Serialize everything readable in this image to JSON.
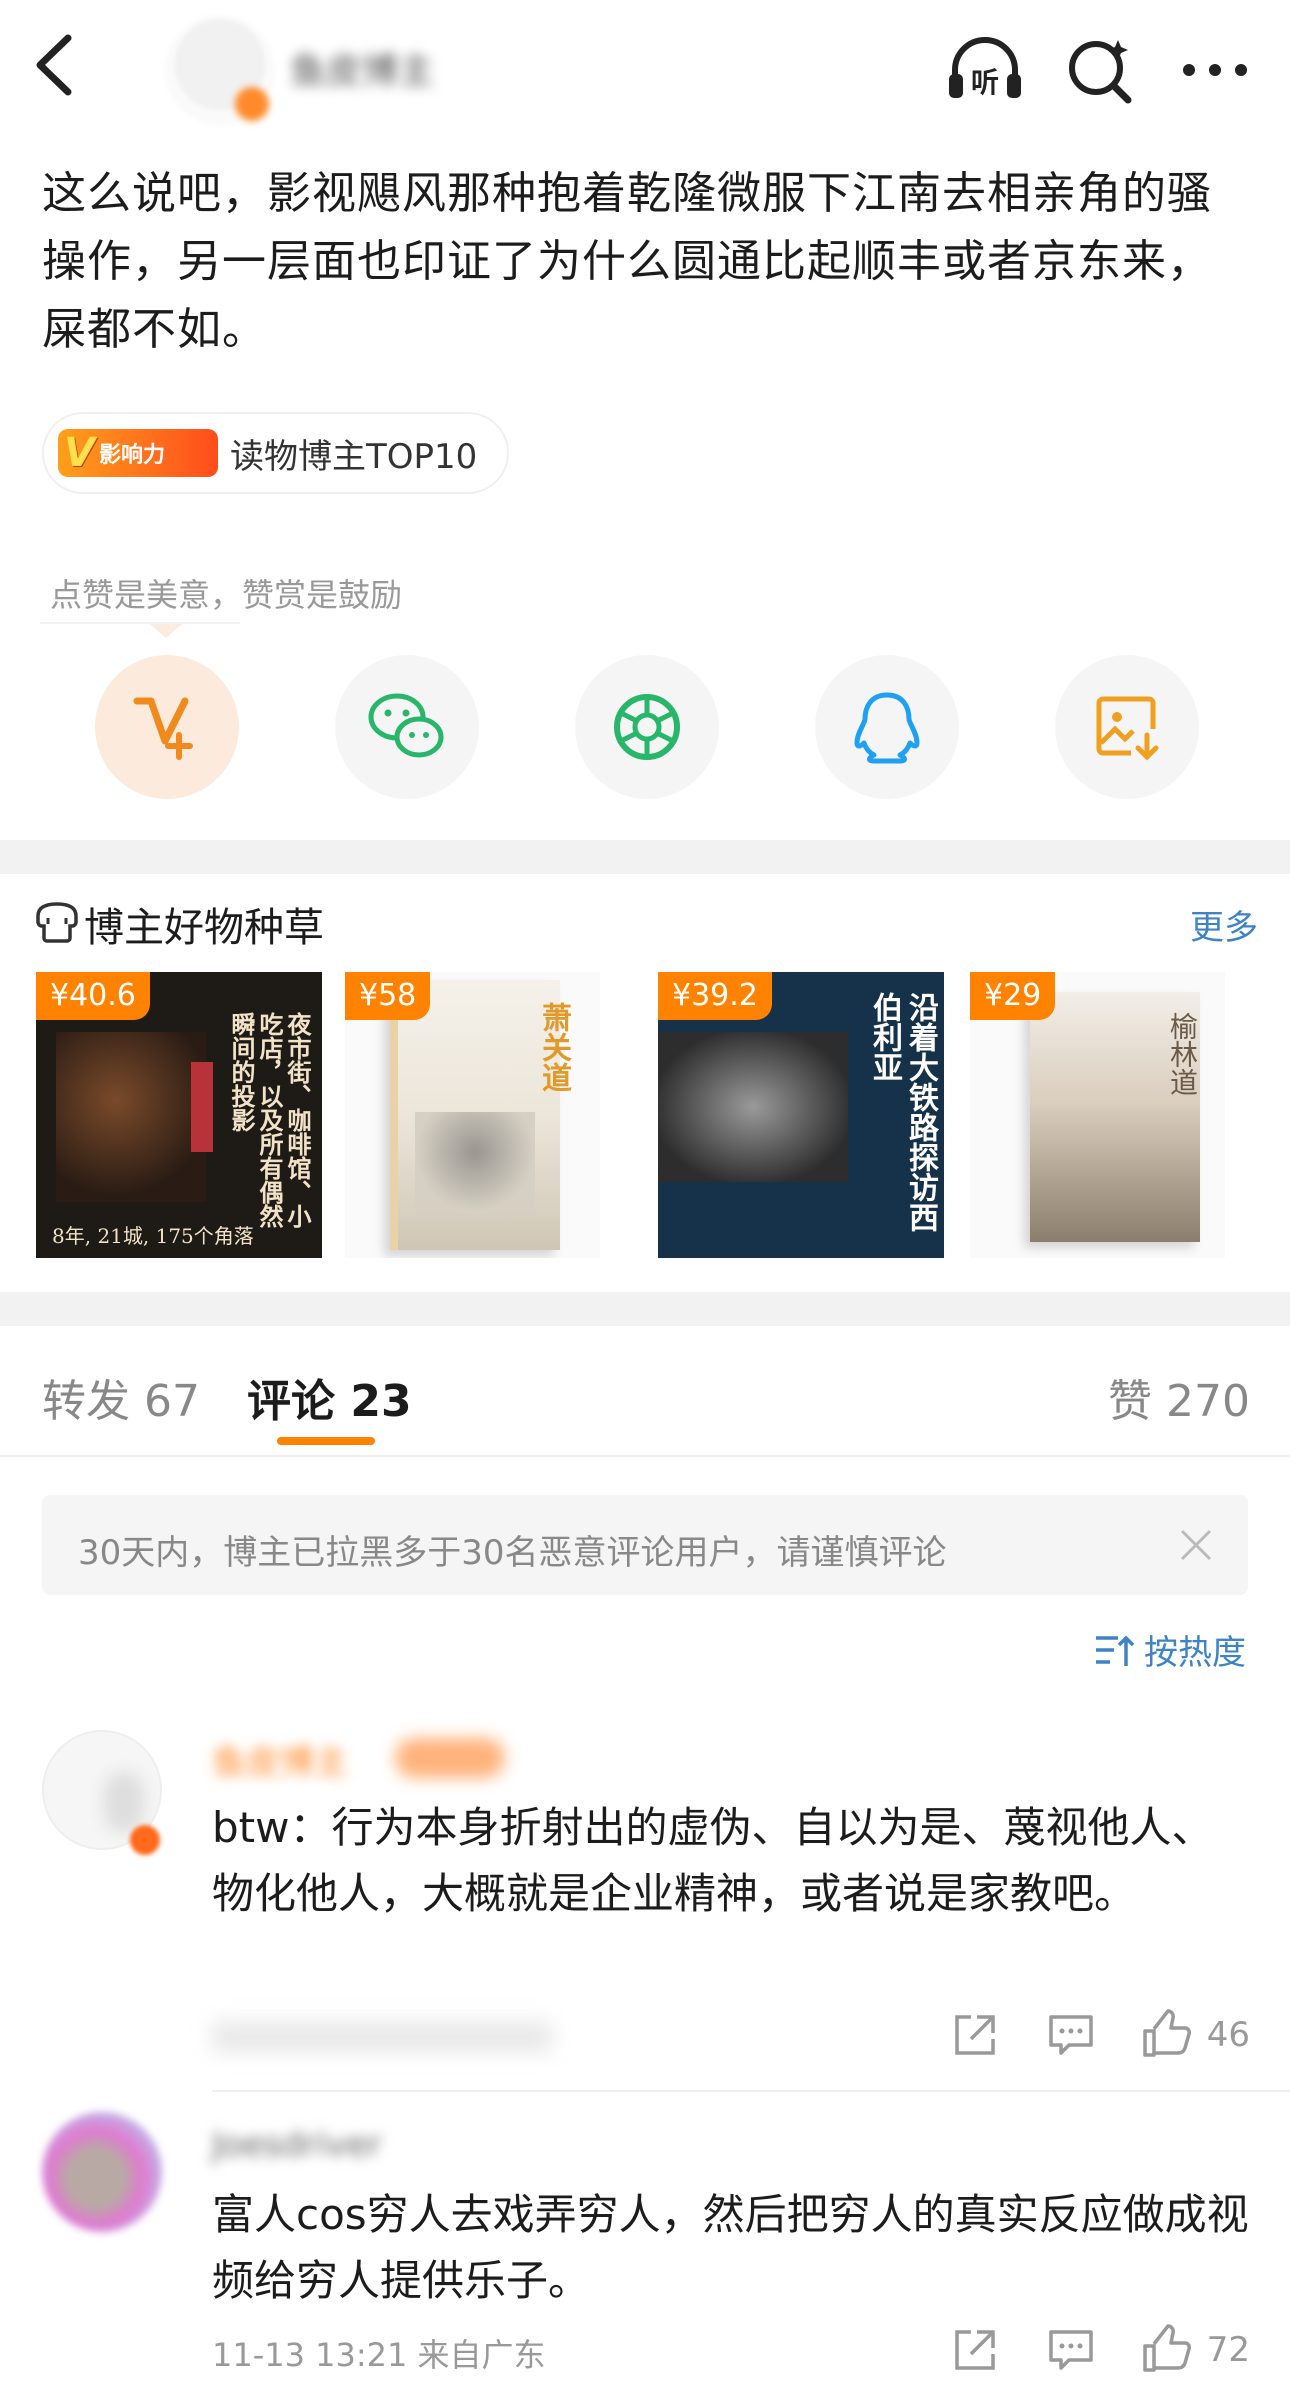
{
  "topbar": {
    "author_name": "鱼皮博主",
    "icons": [
      "back-icon",
      "listen-icon",
      "search-icon",
      "more-icon"
    ],
    "listen_label": "听"
  },
  "post": {
    "text": "这么说吧，影视飓风那种抱着乾隆微服下江南去相亲角的骚操作，另一层面也印证了为什么圆通比起顺丰或者京东来，屎都不如。",
    "badge_logo": "影响力",
    "badge_text": "读物博主TOP10"
  },
  "reward": {
    "hint": "点赞是美意，赞赏是鼓励",
    "share_icons": [
      "reward-icon",
      "wechat-icon",
      "moments-icon",
      "qq-icon",
      "save-image-icon"
    ]
  },
  "goods": {
    "title": "博主好物种草",
    "more_label": "更多",
    "books": [
      {
        "price": "¥40.6",
        "cover_title": "夜市街、咖啡馆、小吃店，以及所有偶然瞬间的投影",
        "subtitle": "8年, 21城, 175个角落"
      },
      {
        "price": "¥58",
        "cover_title": "萧关道"
      },
      {
        "price": "¥39.2",
        "cover_title": "沿着大铁路探访西伯利亚"
      },
      {
        "price": "¥29",
        "cover_title": "榆林道"
      }
    ]
  },
  "tabs": {
    "repost_label": "转发",
    "repost_count": "67",
    "comment_label": "评论",
    "comment_count": "23",
    "like_label": "赞",
    "like_count": "270"
  },
  "notice": {
    "text": "30天内，博主已拉黑多于30名恶意评论用户，请谨慎评论"
  },
  "sort": {
    "label": "按热度"
  },
  "comments": [
    {
      "author": "鱼皮博主",
      "text": "btw：行为本身折射出的虚伪、自以为是、蔑视他人、物化他人，大概就是企业精神，或者说是家教吧。",
      "meta": "",
      "likes": "46"
    },
    {
      "author": "Joesdriver",
      "text": "富人cos穷人去戏弄穷人，然后把穷人的真实反应做成视频给穷人提供乐子。",
      "meta": "11-13 13:21 来自广东",
      "likes": "72"
    }
  ],
  "colors": {
    "accent": "#ff8200",
    "link": "#3d83c6",
    "gray_text": "#999999",
    "section_bg": "#f2f2f2"
  }
}
